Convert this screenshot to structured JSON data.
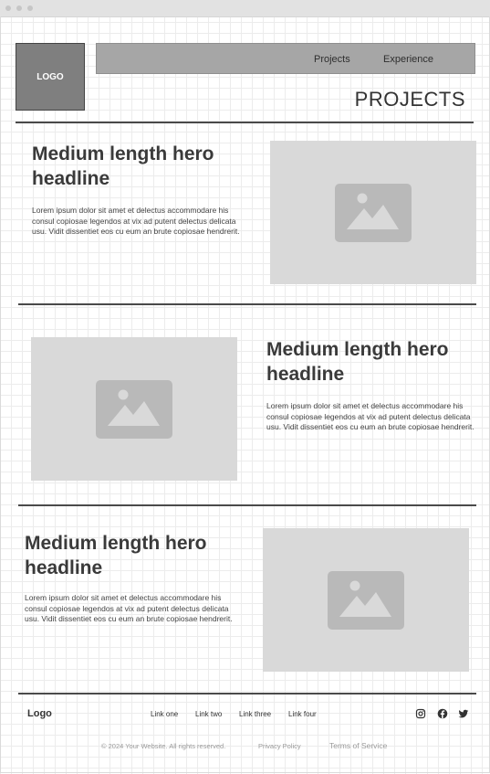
{
  "window": {
    "controls": [
      "close",
      "minimize",
      "maximize"
    ]
  },
  "header": {
    "logo_text": "LOGO",
    "nav": [
      {
        "label": "Projects"
      },
      {
        "label": "Experience"
      }
    ],
    "page_title": "PROJECTS"
  },
  "sections": [
    {
      "headline": "Medium length hero headline",
      "body": "Lorem ipsum dolor sit amet et delectus accommodare his consul copiosae legendos at vix ad putent delectus delicata usu. Vidit dissentiet eos cu eum an brute copiosae hendrerit.",
      "image_icon": "image-placeholder-icon"
    },
    {
      "headline": "Medium length hero headline",
      "body": "Lorem ipsum dolor sit amet et delectus accommodare his consul copiosae legendos at vix ad putent delectus delicata usu. Vidit dissentiet eos cu eum an brute copiosae hendrerit.",
      "image_icon": "image-placeholder-icon"
    },
    {
      "headline": "Medium length hero headline",
      "body": "Lorem ipsum dolor sit amet et delectus accommodare his consul copiosae legendos at vix ad putent delectus delicata usu. Vidit dissentiet eos cu eum an brute copiosae hendrerit.",
      "image_icon": "image-placeholder-icon"
    }
  ],
  "footer": {
    "logo": "Logo",
    "links": [
      "Link one",
      "Link two",
      "Link three",
      "Link four"
    ],
    "social": [
      "instagram-icon",
      "facebook-icon",
      "twitter-icon"
    ],
    "copyright": "© 2024 Your Website. All rights reserved.",
    "privacy": "Privacy Policy",
    "terms": "Terms of Service"
  },
  "colors": {
    "logo_box": "#7f7f7f",
    "nav_bar": "#a6a6a6",
    "placeholder_bg": "#d9d9d9",
    "placeholder_icon": "#b9b9b9",
    "rule": "#4a4a4a"
  }
}
